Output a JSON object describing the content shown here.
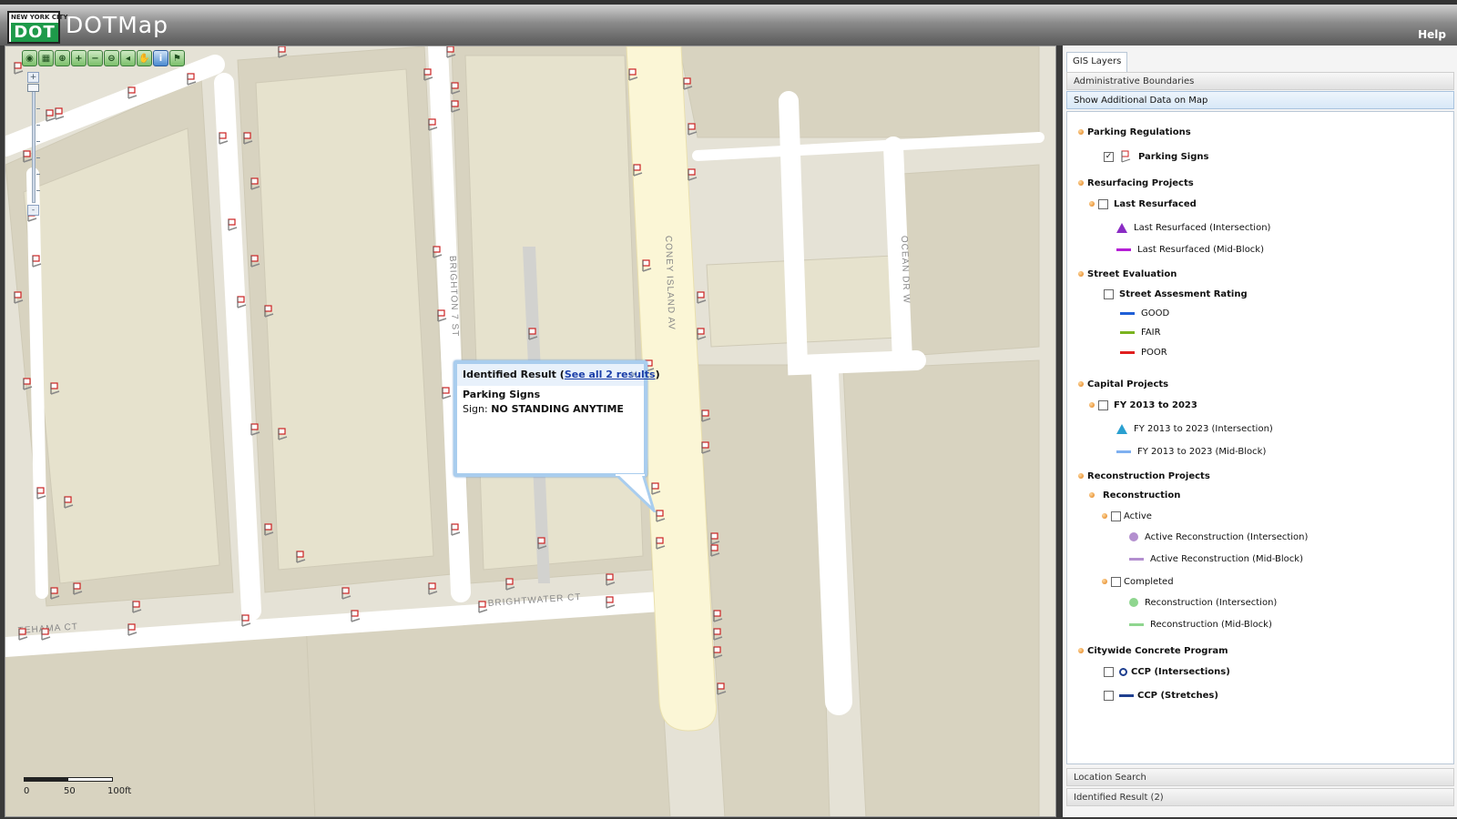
{
  "header": {
    "logo_top": "NEW YORK CITY",
    "logo_main": "DOT",
    "app_title": "DOTMap",
    "help_label": "Help"
  },
  "map": {
    "street_labels": {
      "brighton": "BRIGHTON 7 ST",
      "coney": "CONEY ISLAND AV",
      "ocean": "OCEAN DR W",
      "brightwater": "BRIGHTWATER CT",
      "tehama": "TEHAMA CT"
    },
    "toolbar_icons": [
      "pan-globe-icon",
      "full-extent-icon",
      "zoom-in-box-icon",
      "zoom-in-icon",
      "zoom-out-icon",
      "zoom-out-box-icon",
      "zoom-prev-icon",
      "hand-pan-icon",
      "info-icon",
      "measure-icon"
    ],
    "zoom_plus": "+",
    "zoom_minus": "-",
    "scale": {
      "label_0": "0",
      "label_50": "50",
      "label_100": "100ft"
    },
    "popup": {
      "title_prefix": "Identified Result (",
      "link": "See all 2 results",
      "title_suffix": ")",
      "close": "×",
      "layer": "Parking Signs",
      "sign_label": "Sign:",
      "sign_value": "NO STANDING ANYTIME"
    }
  },
  "panel": {
    "tab_label": "GIS Layers",
    "acc_admin": "Administrative Boundaries",
    "acc_additional": "Show Additional Data on Map",
    "acc_location": "Location Search",
    "acc_identified": "Identified Result (2)",
    "layers": {
      "parking_regulations": "Parking Regulations",
      "parking_signs": "Parking Signs",
      "resurfacing_projects": "Resurfacing Projects",
      "last_resurfaced": "Last Resurfaced",
      "last_resurfaced_intersection": "Last Resurfaced (Intersection)",
      "last_resurfaced_midblock": "Last Resurfaced (Mid-Block)",
      "street_evaluation": "Street Evaluation",
      "street_assessment_rating": "Street Assesment Rating",
      "good": "GOOD",
      "fair": "FAIR",
      "poor": "POOR",
      "capital_projects": "Capital Projects",
      "fy": "FY 2013 to 2023",
      "fy_intersection": "FY 2013 to 2023 (Intersection)",
      "fy_midblock": "FY 2013 to 2023 (Mid-Block)",
      "reconstruction_projects": "Reconstruction Projects",
      "reconstruction": "Reconstruction",
      "active": "Active",
      "active_intersection": "Active Reconstruction (Intersection)",
      "active_midblock": "Active Reconstruction (Mid-Block)",
      "completed": "Completed",
      "completed_intersection": "Reconstruction (Intersection)",
      "completed_midblock": "Reconstruction (Mid-Block)",
      "citywide_concrete": "Citywide Concrete Program",
      "ccp_intersections": "CCP (Intersections)",
      "ccp_stretches": "CCP (Stretches)"
    },
    "checked": {
      "parking_signs": "✓"
    },
    "colors": {
      "good": "#1f5fd6",
      "fair": "#7ab31f",
      "poor": "#e01f1f",
      "last_resurfaced": "#b51fd6",
      "fy_intersection": "#2aa0d0",
      "fy_midblock": "#7fb0f0",
      "active": "#b38fcf",
      "completed": "#8fd68f",
      "ccp": "#1f3f8f"
    }
  }
}
